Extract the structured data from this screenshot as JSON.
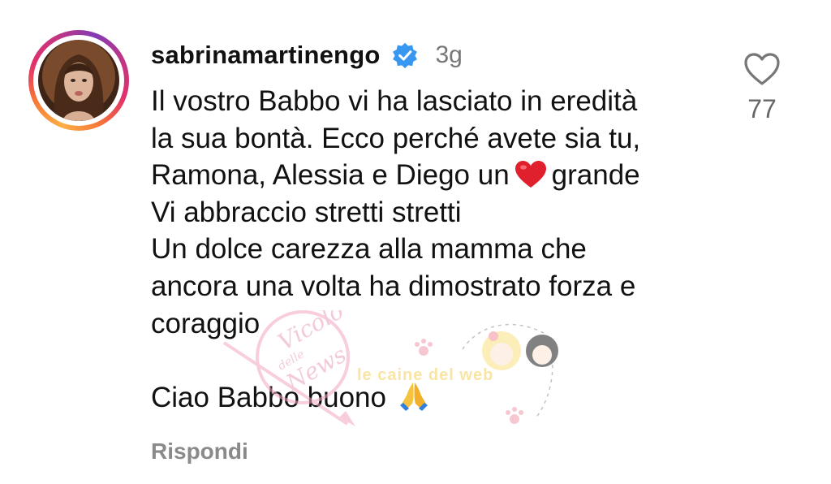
{
  "comment": {
    "username": "sabrinamartinengo",
    "verified_icon": "verified-badge-icon",
    "verified_color": "#3897f0",
    "time_ago": "3g",
    "lines": [
      "Il vostro Babbo vi ha lasciato in eredità",
      "la sua bontà. Ecco perché avete sia tu,",
      "Ramona, Alessia e Diego un",
      "grande",
      "Vi abbraccio stretti stretti",
      "Un dolce carezza alla mamma che",
      "ancora una volta ha dimostrato forza e",
      "coraggio",
      "Ciao Babbo buono"
    ],
    "heart_emoji": "❤️",
    "pray_emoji": "🙏",
    "reply_label": "Rispondi"
  },
  "like": {
    "icon": "heart-outline-icon",
    "count": "77"
  },
  "watermarks": {
    "stamp_text_1": "Vicolo",
    "stamp_text_2": "delle",
    "stamp_text_3": "News",
    "brand_text": "le caine del web"
  },
  "colors": {
    "ring_start": "#fcaf45",
    "ring_mid": "#e1306c",
    "ring_end": "#833ab4",
    "secondary_text": "#777777",
    "heart_red": "#e0202d"
  }
}
